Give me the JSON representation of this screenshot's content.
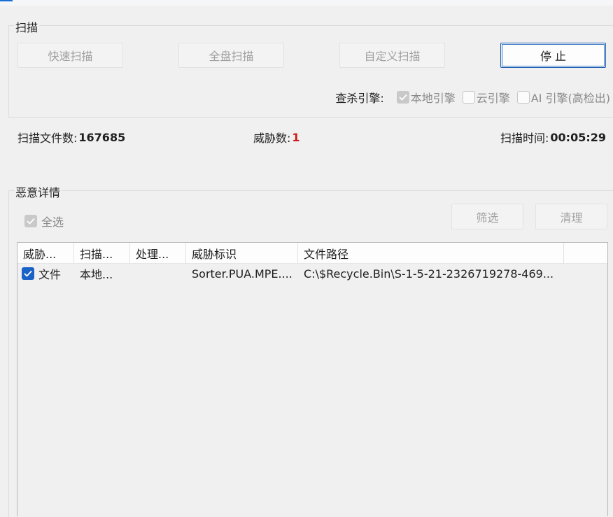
{
  "scan_group": {
    "title": "扫描",
    "buttons": {
      "quick": "快速扫描",
      "full": "全盘扫描",
      "custom": "自定义扫描",
      "stop": "停 止"
    },
    "engines": {
      "label": "查杀引擎:",
      "local": "本地引擎",
      "cloud": "云引擎",
      "ai": "AI 引擎(高检出)"
    }
  },
  "stats": {
    "files_label": "扫描文件数:",
    "files_value": "167685",
    "threats_label": "威胁数:",
    "threats_value": "1",
    "time_label": "扫描时间:",
    "time_value": "00:05:29"
  },
  "detail_group": {
    "title": "恶意详情",
    "select_all": "全选",
    "filter": "筛选",
    "clean": "清理",
    "columns": [
      "威胁...",
      "扫描...",
      "处理...",
      "威胁标识",
      "文件路径"
    ],
    "rows": [
      {
        "type": "文件",
        "scan": "本地...",
        "handle": "",
        "threat_id": "Sorter.PUA.MPE....",
        "path": "C:\\$Recycle.Bin\\S-1-5-21-2326719278-469..."
      }
    ]
  },
  "colors": {
    "accent": "#1a62c6",
    "threat_red": "#d01a1a"
  }
}
